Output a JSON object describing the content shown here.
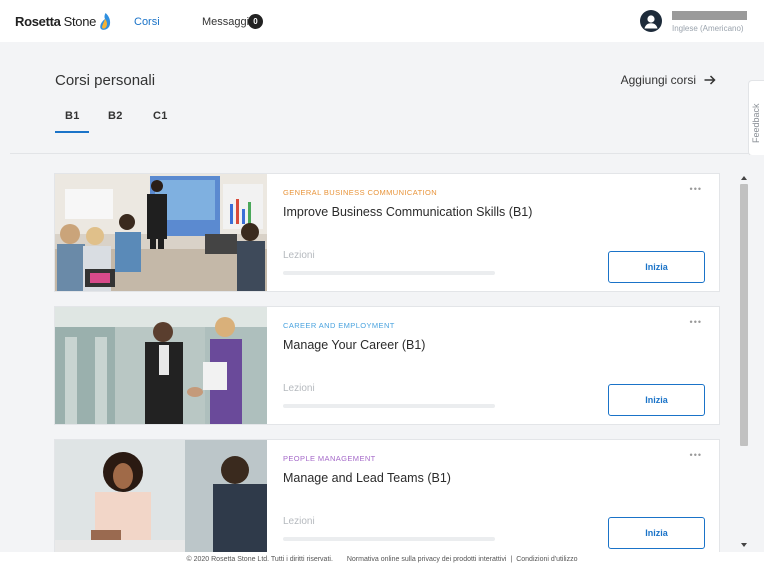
{
  "nav": {
    "logo_bold": "Rosetta",
    "logo_regular": "Stone",
    "corsi": "Corsi",
    "messaggi": "Messaggi",
    "messaggi_count": "0",
    "user_language": "Inglese (Americano)"
  },
  "header": {
    "title": "Corsi personali",
    "add_courses": "Aggiungi corsi",
    "tabs": [
      "B1",
      "B2",
      "C1"
    ],
    "active_tab": "B1"
  },
  "feedback_label": "Feedback",
  "courses": [
    {
      "category": "GENERAL BUSINESS COMMUNICATION",
      "category_color": "#e8943a",
      "title": "Improve Business Communication Skills (B1)",
      "lessons_label": "Lezioni",
      "more": "•••",
      "button": "Inizia"
    },
    {
      "category": "CAREER AND EMPLOYMENT",
      "category_color": "#4aa3df",
      "title": "Manage Your Career (B1)",
      "lessons_label": "Lezioni",
      "more": "•••",
      "button": "Inizia"
    },
    {
      "category": "PEOPLE MANAGEMENT",
      "category_color": "#a56ac9",
      "title": "Manage and Lead Teams (B1)",
      "lessons_label": "Lezioni",
      "more": "•••",
      "button": "Inizia"
    }
  ],
  "footer": {
    "copyright": "© 2020 Rosetta Stone Ltd. Tutti i diritti riservati.",
    "privacy": "Normativa online sulla privacy dei prodotti interattivi",
    "separator": "|",
    "terms": "Condizioni d'utilizzo"
  },
  "colors": {
    "accent": "#1a73c8",
    "background": "#f3f4f6"
  }
}
